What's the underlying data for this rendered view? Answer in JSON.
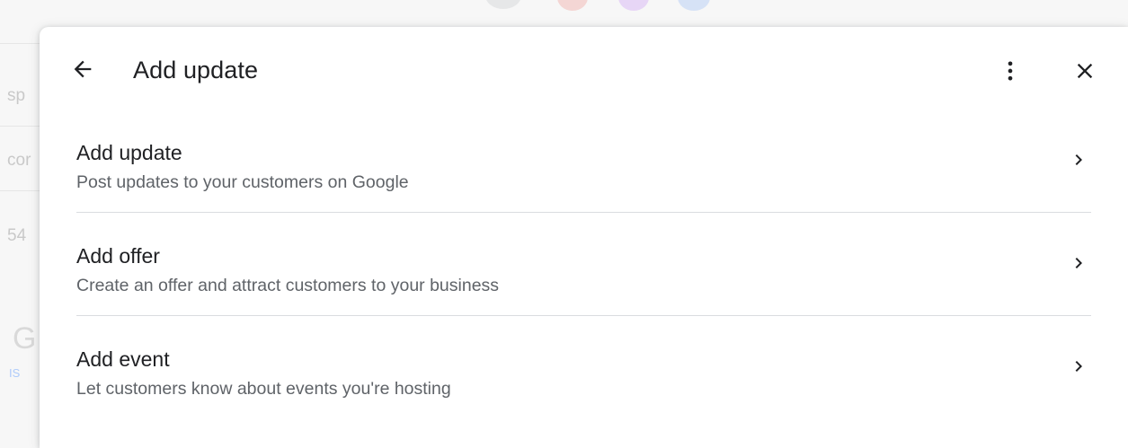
{
  "dialog": {
    "title": "Add update",
    "back_icon": "arrow-back-icon",
    "more_icon": "more-vert-icon",
    "close_icon": "close-icon"
  },
  "options": [
    {
      "title": "Add update",
      "description": "Post updates to your customers on Google",
      "icon": "chevron-right-icon"
    },
    {
      "title": "Add offer",
      "description": "Create an offer and attract customers to your business",
      "icon": "chevron-right-icon"
    },
    {
      "title": "Add event",
      "description": "Let customers know about events you're hosting",
      "icon": "chevron-right-icon"
    }
  ],
  "background": {
    "fragments": [
      "sp",
      "cor",
      "54"
    ],
    "logo_letter": "G",
    "link_fragment": "IS"
  },
  "colors": {
    "text_primary": "#202124",
    "text_secondary": "#5f6368",
    "divider": "#dadce0",
    "icon": "#202124"
  }
}
